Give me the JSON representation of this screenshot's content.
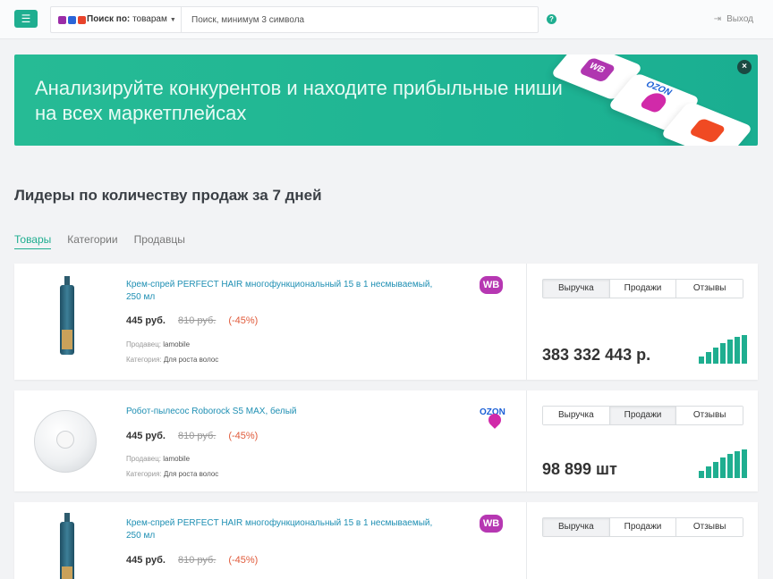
{
  "topbar": {
    "menu_icon": "hamburger-icon",
    "marketplace_icons": [
      "wildberries-icon",
      "ozon-icon",
      "aliexpress-icon"
    ],
    "search_by_label": "Поиск по:",
    "search_by_value": "товарам",
    "search_placeholder": "Поиск, минимум 3 символа",
    "help_icon": "?",
    "logout_label": "Выход"
  },
  "banner": {
    "text": "Анализируйте конкурентов и находите прибыльные ниши на всех маркетплейсах",
    "close_icon": "×",
    "tiles": [
      "wildberries-tile",
      "ozon-tile",
      "aliexpress-tile"
    ],
    "wb_text": "WB",
    "ozon_text": "OZON"
  },
  "section": {
    "title": "Лидеры по количеству продаж за 7 дней",
    "tabs": [
      "Товары",
      "Категории",
      "Продавцы"
    ],
    "active_tab": "Товары"
  },
  "metric_tabs": [
    "Выручка",
    "Продажи",
    "Отзывы"
  ],
  "labels": {
    "seller": "Продавец:",
    "category": "Категория:"
  },
  "products": [
    {
      "name": "Крем-спрей PERFECT HAIR многофункциональный 15 в 1 несмываемый, 250 мл",
      "price": "445 руб.",
      "old_price": "810 руб.",
      "discount": "(-45%)",
      "seller": "lamobile",
      "category": "Для роста волос",
      "marketplace": "WB",
      "active_metric": "Выручка",
      "value": "383 332 443 р."
    },
    {
      "name": "Робот-пылесос Roborock S5 MAX, белый",
      "price": "445 руб.",
      "old_price": "810 руб.",
      "discount": "(-45%)",
      "seller": "lamobile",
      "category": "Для роста волос",
      "marketplace": "OZON",
      "active_metric": "Продажи",
      "value": "98 899 шт"
    },
    {
      "name": "Крем-спрей PERFECT HAIR многофункциональный 15 в 1 несмываемый, 250 мл",
      "price": "445 руб.",
      "old_price": "810 руб.",
      "discount": "(-45%)",
      "marketplace": "WB",
      "active_metric": "Выручка"
    }
  ],
  "colors": {
    "accent": "#1fae90",
    "link": "#1e8fb3",
    "discount": "#e05a3a",
    "wb": "#b637b2",
    "ozon": "#1a5fd6"
  }
}
